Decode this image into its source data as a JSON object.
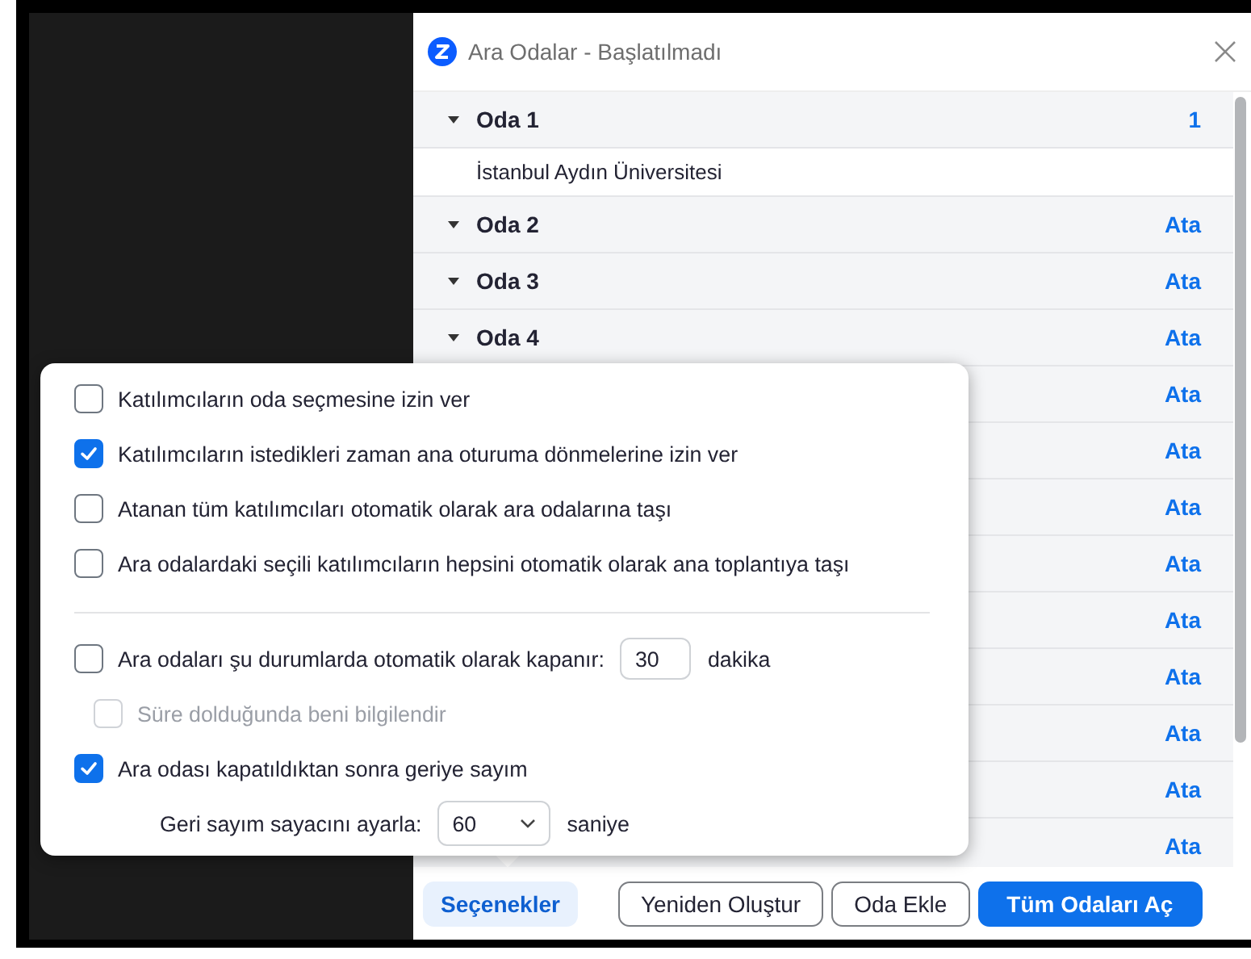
{
  "window": {
    "title": "Ara Odalar - Başlatılmadı"
  },
  "rooms": [
    {
      "name": "Oda 1",
      "expanded": true,
      "count": "1",
      "members": [
        "İstanbul Aydın Üniversitesi"
      ]
    },
    {
      "name": "Oda 2",
      "expanded": true,
      "action": "Ata"
    },
    {
      "name": "Oda 3",
      "expanded": true,
      "action": "Ata"
    },
    {
      "name": "Oda 4",
      "expanded": true,
      "action": "Ata"
    },
    {
      "action": "Ata"
    },
    {
      "action": "Ata"
    },
    {
      "action": "Ata"
    },
    {
      "action": "Ata"
    },
    {
      "action": "Ata"
    },
    {
      "action": "Ata"
    },
    {
      "action": "Ata"
    },
    {
      "action": "Ata"
    },
    {
      "action": "Ata"
    }
  ],
  "options": {
    "sections": [
      {
        "items": [
          {
            "kind": "checkbox",
            "label": "Katılımcıların oda seçmesine izin ver",
            "checked": false,
            "disabled": false
          },
          {
            "kind": "checkbox",
            "label": "Katılımcıların istedikleri zaman ana oturuma dönmelerine izin ver",
            "checked": true,
            "disabled": false
          },
          {
            "kind": "checkbox",
            "label": "Atanan tüm katılımcıları otomatik olarak ara odalarına taşı",
            "checked": false,
            "disabled": false
          },
          {
            "kind": "checkbox",
            "label": "Ara odalardaki seçili katılımcıların hepsini otomatik olarak ana toplantıya taşı",
            "checked": false,
            "disabled": false
          }
        ]
      },
      {
        "items": [
          {
            "kind": "checkbox",
            "label": "Ara odaları şu durumlarda otomatik olarak kapanır:",
            "checked": false,
            "disabled": false,
            "input": {
              "value": "30"
            },
            "unit": "dakika",
            "children": [
              {
                "kind": "checkbox",
                "label": "Süre dolduğunda beni bilgilendir",
                "checked": false,
                "disabled": true
              }
            ]
          },
          {
            "kind": "checkbox",
            "label": "Ara odası kapatıldıktan sonra geriye sayım",
            "checked": true,
            "disabled": false,
            "children": [
              {
                "kind": "select",
                "label": "Geri sayım sayacını ayarla:",
                "value": "60",
                "unit": "saniye"
              }
            ]
          }
        ]
      }
    ]
  },
  "footer": {
    "buttons": [
      {
        "label": "Seçenekler",
        "kind": "subtle"
      },
      {
        "label": "Yeniden Oluştur",
        "kind": "outline"
      },
      {
        "label": "Oda Ekle",
        "kind": "outline"
      },
      {
        "label": "Tüm Odaları Aç",
        "kind": "primary"
      }
    ]
  }
}
